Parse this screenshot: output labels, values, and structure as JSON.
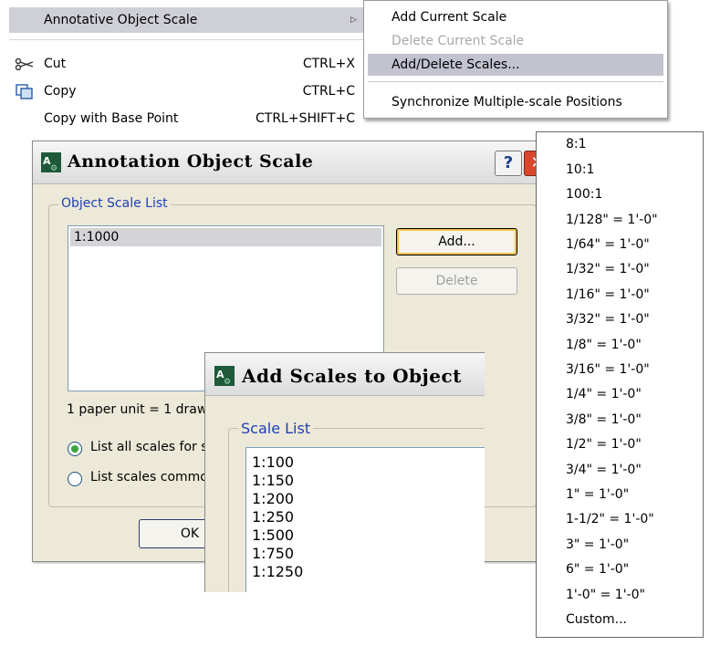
{
  "context_menu": {
    "items": [
      {
        "label": "Annotative Object Scale",
        "shortcut": ""
      },
      {
        "label": "Cut",
        "shortcut": "CTRL+X",
        "icon": "scissors-icon"
      },
      {
        "label": "Copy",
        "shortcut": "CTRL+C",
        "icon": "copy-icon"
      },
      {
        "label": "Copy with Base Point",
        "shortcut": "CTRL+SHIFT+C"
      }
    ],
    "submenu_arrow": "▷",
    "submenu": [
      {
        "label": "Add Current Scale",
        "enabled": true
      },
      {
        "label": "Delete Current Scale",
        "enabled": false
      },
      {
        "label": "Add/Delete Scales...",
        "enabled": true,
        "highlighted": true
      },
      {
        "label": "Synchronize Multiple-scale Positions",
        "enabled": true
      }
    ]
  },
  "annotation_dialog": {
    "title": "Annotation Object Scale",
    "help": "?",
    "close": "✕",
    "group_label": "Object Scale List",
    "scales": [
      "1:1000"
    ],
    "add_button": "Add...",
    "delete_button": "Delete",
    "paper_units_text": "1 paper unit = 1 draw",
    "radio_all": "List all scales for s",
    "radio_common": "List scales commo",
    "ok_button": "OK"
  },
  "add_scales_dialog": {
    "title": "Add Scales to Object",
    "group_label": "Scale List",
    "scales": [
      "1:100",
      "1:150",
      "1:200",
      "1:250",
      "1:500",
      "1:750",
      "1:1250"
    ]
  },
  "scale_dropdown": {
    "items": [
      "8:1",
      "10:1",
      "100:1",
      "1/128\" = 1'-0\"",
      "1/64\" = 1'-0\"",
      "1/32\" = 1'-0\"",
      "1/16\" = 1'-0\"",
      "3/32\" = 1'-0\"",
      "1/8\" = 1'-0\"",
      "3/16\" = 1'-0\"",
      "1/4\" = 1'-0\"",
      "3/8\" = 1'-0\"",
      "1/2\" = 1'-0\"",
      "3/4\" = 1'-0\"",
      "1\" = 1'-0\"",
      "1-1/2\" = 1'-0\"",
      "3\" = 1'-0\"",
      "6\" = 1'-0\"",
      "1'-0\" = 1'-0\"",
      "Custom..."
    ]
  },
  "colors": {
    "dialog_bg": "#ece9d8",
    "group_label": "#1f3fb8",
    "close_button": "#d8472c",
    "selection": "#d3d3d8"
  }
}
